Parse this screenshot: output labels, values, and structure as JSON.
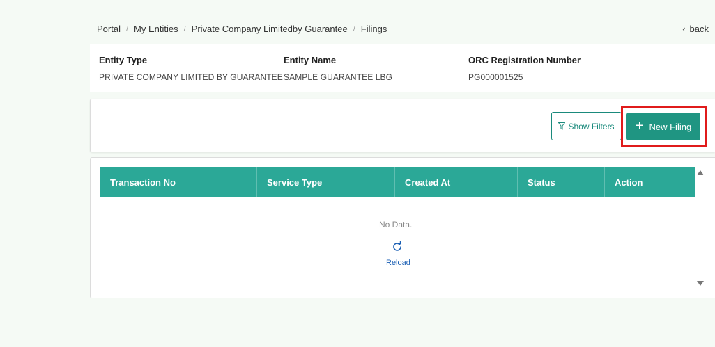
{
  "breadcrumb": {
    "items": [
      "Portal",
      "My Entities",
      "Private Company Limitedby Guarantee",
      "Filings"
    ],
    "separator": "/"
  },
  "back_label": "back",
  "entity": {
    "type_label": "Entity Type",
    "type_value": "PRIVATE COMPANY LIMITED BY GUARANTEE",
    "name_label": "Entity Name",
    "name_value": "SAMPLE GUARANTEE LBG",
    "reg_label": "ORC Registration Number",
    "reg_value": "PG000001525"
  },
  "toolbar": {
    "show_filters_label": "Show Filters",
    "new_filing_label": "New Filing"
  },
  "table": {
    "columns": [
      "Transaction No",
      "Service Type",
      "Created At",
      "Status",
      "Action"
    ],
    "empty_text": "No Data.",
    "reload_label": "Reload"
  },
  "colors": {
    "accent": "#1f9582",
    "header": "#2ba897",
    "highlight": "#e01b1b"
  }
}
